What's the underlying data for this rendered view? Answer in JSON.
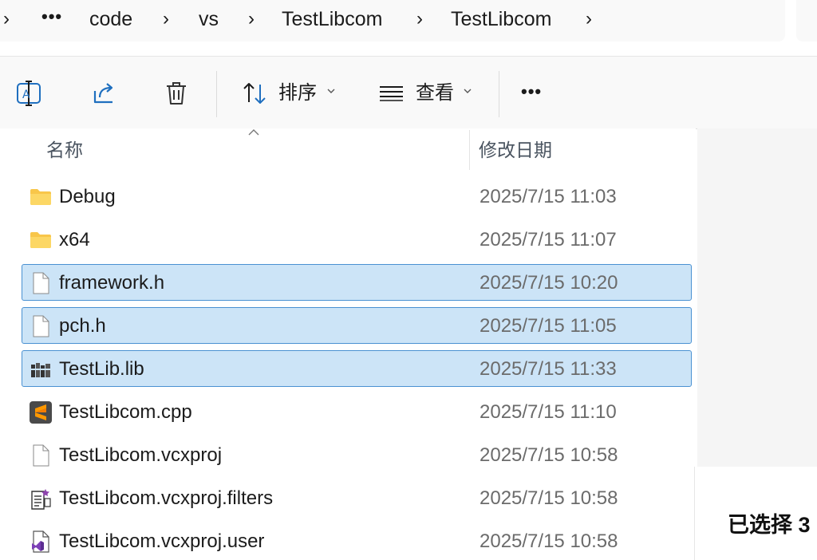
{
  "breadcrumb": {
    "overflow_label": "•••",
    "items": [
      "code",
      "vs",
      "TestLibcom",
      "TestLibcom"
    ]
  },
  "toolbar": {
    "sort_label": "排序",
    "view_label": "查看",
    "more_label": "•••",
    "icons": [
      "rename-icon",
      "share-icon",
      "delete-icon",
      "sort-icon",
      "view-icon",
      "more-icon"
    ]
  },
  "columns": {
    "name": "名称",
    "date_modified": "修改日期"
  },
  "files": [
    {
      "name": "Debug",
      "date": "2025/7/15 11:03",
      "icon": "folder-icon",
      "selected": false
    },
    {
      "name": "x64",
      "date": "2025/7/15 11:07",
      "icon": "folder-icon",
      "selected": false
    },
    {
      "name": "framework.h",
      "date": "2025/7/15 10:20",
      "icon": "file-icon",
      "selected": true
    },
    {
      "name": "pch.h",
      "date": "2025/7/15 11:05",
      "icon": "file-icon",
      "selected": true
    },
    {
      "name": "TestLib.lib",
      "date": "2025/7/15 11:33",
      "icon": "library-icon",
      "selected": true
    },
    {
      "name": "TestLibcom.cpp",
      "date": "2025/7/15 11:10",
      "icon": "sublime-icon",
      "selected": false
    },
    {
      "name": "TestLibcom.vcxproj",
      "date": "2025/7/15 10:58",
      "icon": "file-icon",
      "selected": false
    },
    {
      "name": "TestLibcom.vcxproj.filters",
      "date": "2025/7/15 10:58",
      "icon": "filters-icon",
      "selected": false
    },
    {
      "name": "TestLibcom.vcxproj.user",
      "date": "2025/7/15 10:58",
      "icon": "vs-user-icon",
      "selected": false
    }
  ],
  "details": {
    "selection_status": "已选择 3"
  },
  "colors": {
    "selection_bg": "#cce4f7",
    "selection_border": "#4a91d2",
    "folder": "#f8c64a",
    "accent": "#1f6fbf"
  }
}
